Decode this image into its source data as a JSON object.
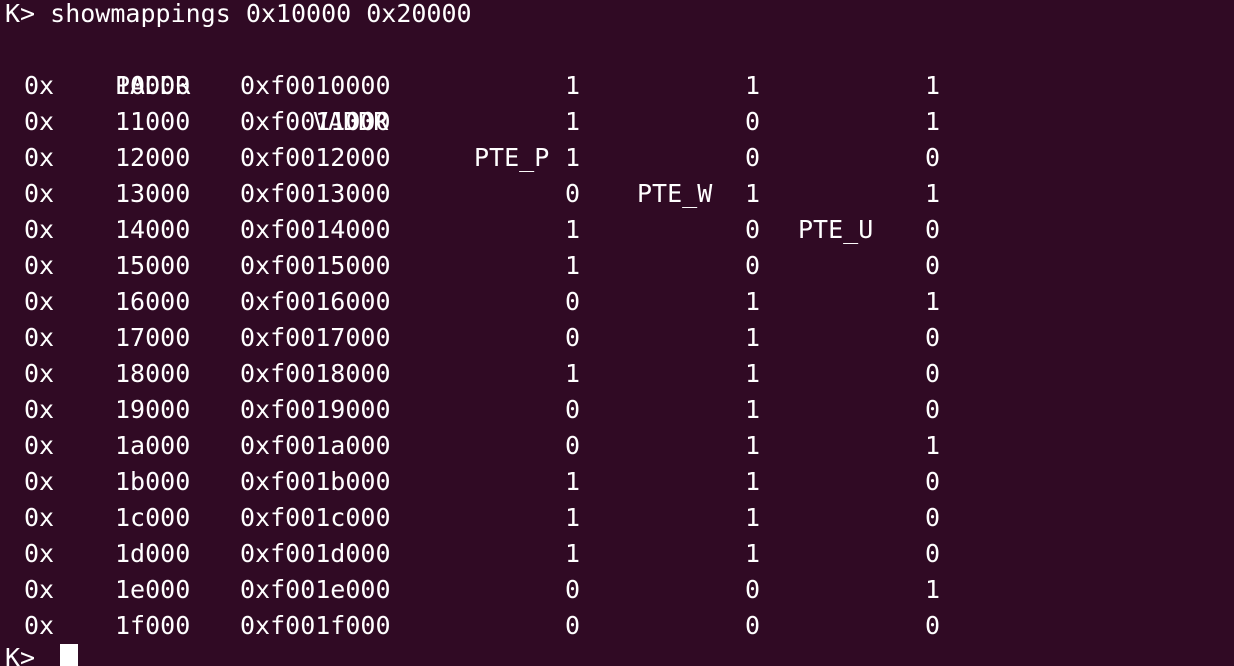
{
  "command_line": "K> showmappings 0x10000 0x20000",
  "header": {
    "paddr": "PADDR",
    "vaddr": "VADDR",
    "pte_p": "PTE_P",
    "pte_w": "PTE_W",
    "pte_u": "PTE_U"
  },
  "rows": [
    {
      "prefix": "0x",
      "paddr": "10000",
      "vaddr": "0xf0010000",
      "pte_p": "1",
      "pte_w": "1",
      "pte_u": "1"
    },
    {
      "prefix": "0x",
      "paddr": "11000",
      "vaddr": "0xf0011000",
      "pte_p": "1",
      "pte_w": "0",
      "pte_u": "1"
    },
    {
      "prefix": "0x",
      "paddr": "12000",
      "vaddr": "0xf0012000",
      "pte_p": "1",
      "pte_w": "0",
      "pte_u": "0"
    },
    {
      "prefix": "0x",
      "paddr": "13000",
      "vaddr": "0xf0013000",
      "pte_p": "0",
      "pte_w": "1",
      "pte_u": "1"
    },
    {
      "prefix": "0x",
      "paddr": "14000",
      "vaddr": "0xf0014000",
      "pte_p": "1",
      "pte_w": "0",
      "pte_u": "0"
    },
    {
      "prefix": "0x",
      "paddr": "15000",
      "vaddr": "0xf0015000",
      "pte_p": "1",
      "pte_w": "0",
      "pte_u": "0"
    },
    {
      "prefix": "0x",
      "paddr": "16000",
      "vaddr": "0xf0016000",
      "pte_p": "0",
      "pte_w": "1",
      "pte_u": "1"
    },
    {
      "prefix": "0x",
      "paddr": "17000",
      "vaddr": "0xf0017000",
      "pte_p": "0",
      "pte_w": "1",
      "pte_u": "0"
    },
    {
      "prefix": "0x",
      "paddr": "18000",
      "vaddr": "0xf0018000",
      "pte_p": "1",
      "pte_w": "1",
      "pte_u": "0"
    },
    {
      "prefix": "0x",
      "paddr": "19000",
      "vaddr": "0xf0019000",
      "pte_p": "0",
      "pte_w": "1",
      "pte_u": "0"
    },
    {
      "prefix": "0x",
      "paddr": "1a000",
      "vaddr": "0xf001a000",
      "pte_p": "0",
      "pte_w": "1",
      "pte_u": "1"
    },
    {
      "prefix": "0x",
      "paddr": "1b000",
      "vaddr": "0xf001b000",
      "pte_p": "1",
      "pte_w": "1",
      "pte_u": "0"
    },
    {
      "prefix": "0x",
      "paddr": "1c000",
      "vaddr": "0xf001c000",
      "pte_p": "1",
      "pte_w": "1",
      "pte_u": "0"
    },
    {
      "prefix": "0x",
      "paddr": "1d000",
      "vaddr": "0xf001d000",
      "pte_p": "1",
      "pte_w": "1",
      "pte_u": "0"
    },
    {
      "prefix": "0x",
      "paddr": "1e000",
      "vaddr": "0xf001e000",
      "pte_p": "0",
      "pte_w": "0",
      "pte_u": "1"
    },
    {
      "prefix": "0x",
      "paddr": "1f000",
      "vaddr": "0xf001f000",
      "pte_p": "0",
      "pte_w": "0",
      "pte_u": "0"
    }
  ],
  "prompt": "K>",
  "colors": {
    "background": "#300a24",
    "foreground": "#ffffff"
  }
}
